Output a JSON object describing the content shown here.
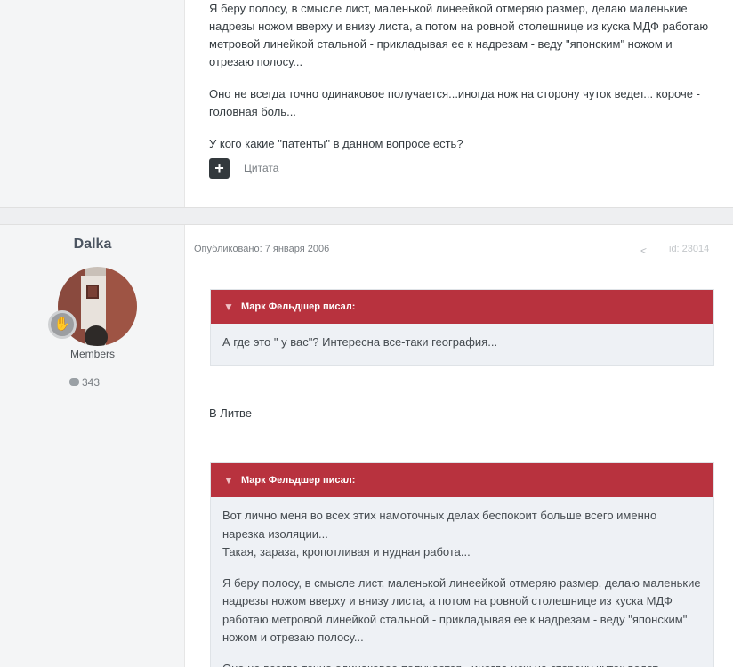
{
  "post1": {
    "paragraphs": [
      "Я беру полосу, в смысле лист, маленькой линеейкой отмеряю размер, делаю маленькие надрезы ножом вверху и внизу листа, а потом на ровной столешнице из куска МДФ работаю метровой линейкой стальной - прикладывая ее к надрезам - веду \"японским\" ножом и отрезаю полосу...",
      "Оно не всегда точно одинаковое получается...иногда нож на сторону чуток ведет... короче - головная боль...",
      "У кого какие \"патенты\" в данном вопросе есть?"
    ],
    "plus_label": "+",
    "quote_label": "Цитата"
  },
  "post2": {
    "author": "Dalka",
    "group": "Members",
    "post_count": "343",
    "published": "Опубликовано: 7 января 2006",
    "post_id": "id: 23014",
    "quote1": {
      "header": "Марк Фельдшер писал:",
      "text": "А где это \" у вас\"? Интересна все-таки география..."
    },
    "reply_text": "В Литве",
    "quote2": {
      "header": "Марк Фельдшер писал:",
      "p1": "Вот лично меня во всех этих намоточных делах беспокоит больше всего именно нарезка изоляции...",
      "p1b": "Такая, зараза, кропотливая и нудная работа...",
      "p2": "Я беру полосу, в смысле лист, маленькой линеейкой отмеряю размер, делаю маленькие надрезы ножом вверху и внизу листа, а потом на ровной столешнице из куска МДФ работаю метровой линейкой стальной - прикладывая ее к надрезам - веду \"японским\" ножом и отрезаю полосу...",
      "p3": "Оно не всегда точно одинаковое получается...иногда нож на сторону чуток ведет..."
    }
  },
  "icons": {
    "rank": "rank-badge-icon",
    "comments": "comment-bubble-icon",
    "share": "share-icon",
    "chevron": "chevron-down-icon"
  },
  "colors": {
    "quote_header": "#b8323e",
    "quote_bg": "#eef1f5",
    "button_dark": "#33393d"
  }
}
